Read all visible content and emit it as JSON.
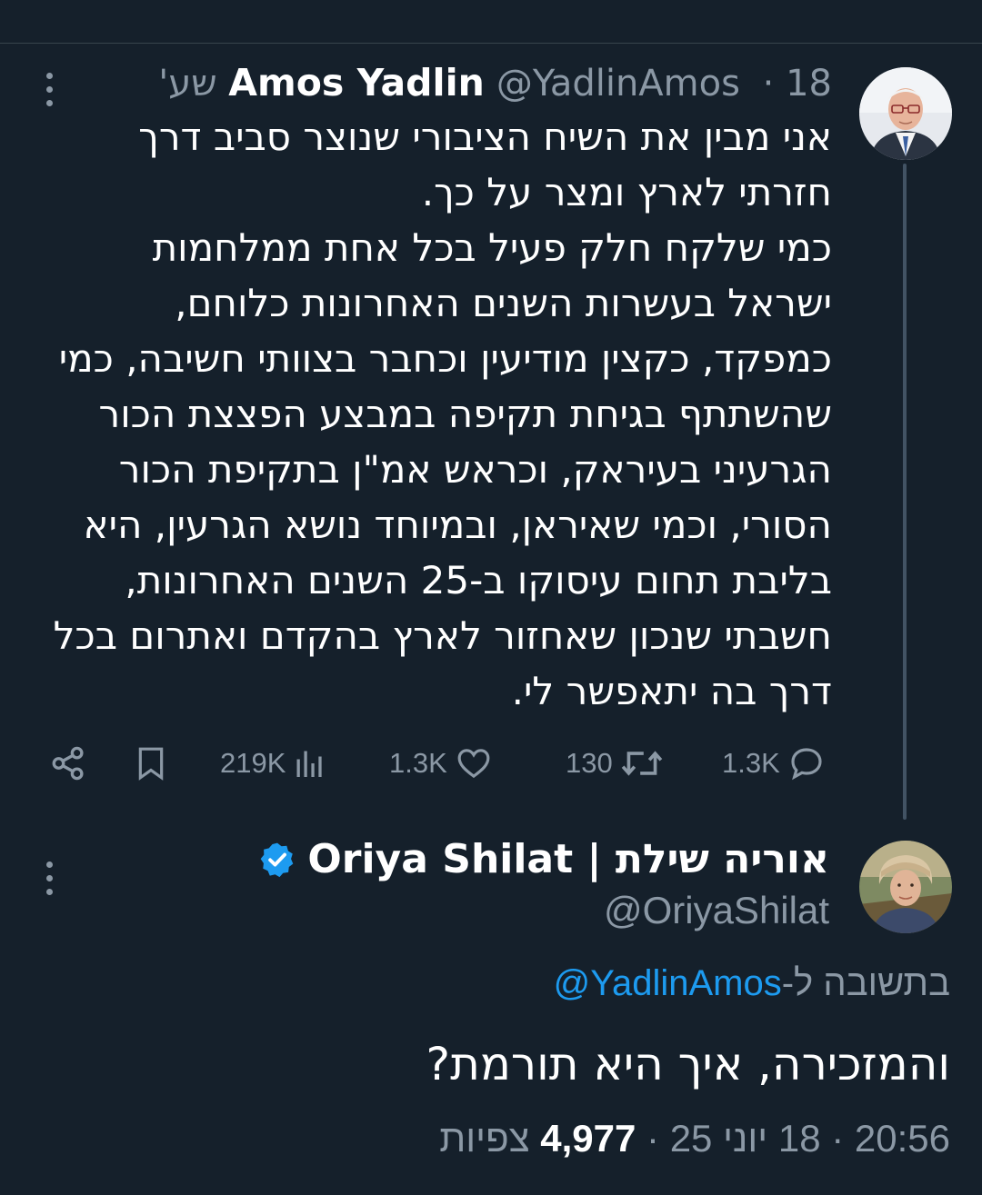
{
  "tweet": {
    "author_name": "Amos Yadlin",
    "author_handle": "@YadlinAmos",
    "separator": " · ",
    "time_ago": "18 שע'",
    "text": "אני מבין את השיח הציבורי שנוצר סביב דרך חזרתי לארץ ומצר על כך.\nכמי שלקח חלק פעיל בכל אחת ממלחמות ישראל בעשרות השנים האחרונות כלוחם, כמפקד, כקצין מודיעין וכחבר בצוותי חשיבה, כמי שהשתתף בגיחת תקיפה במבצע הפצצת הכור הגרעיני בעיראק, וכראש אמ\"ן בתקיפת הכור הסורי, וכמי שאיראן, ובמיוחד נושא הגרעין, היא בליבת תחום עיסוקו ב-25 השנים האחרונות, חשבתי שנכון שאחזור לארץ בהקדם ואתרום בכל דרך בה יתאפשר לי.",
    "stats": {
      "replies": "1.3K",
      "reposts": "130",
      "likes": "1.3K",
      "views": "219K"
    },
    "icons": {
      "more": "more-dots-icon",
      "reply": "reply-bubble-icon",
      "repost": "repost-icon",
      "like": "heart-icon",
      "views": "views-bars-icon",
      "bookmark": "bookmark-icon",
      "share": "share-icon"
    }
  },
  "reply": {
    "author_name": "אוריה שילת | Oriya Shilat",
    "author_handle": "@OriyaShilat",
    "verified_icon": "verified-badge-icon",
    "replying_prefix": "בתשובה ל-",
    "replying_to": "@YadlinAmos",
    "text": "והמזכירה, איך היא תורמת?",
    "time": "20:56",
    "sep1": " · ",
    "date": "18 יוני 25",
    "sep2": " · ",
    "views_count": "4,977",
    "views_label": "צפיות"
  },
  "colors": {
    "background": "#15202b",
    "text_primary": "#ffffff",
    "text_secondary": "#8b98a5",
    "accent_blue": "#1d9bf0",
    "thread_line": "#425364"
  }
}
